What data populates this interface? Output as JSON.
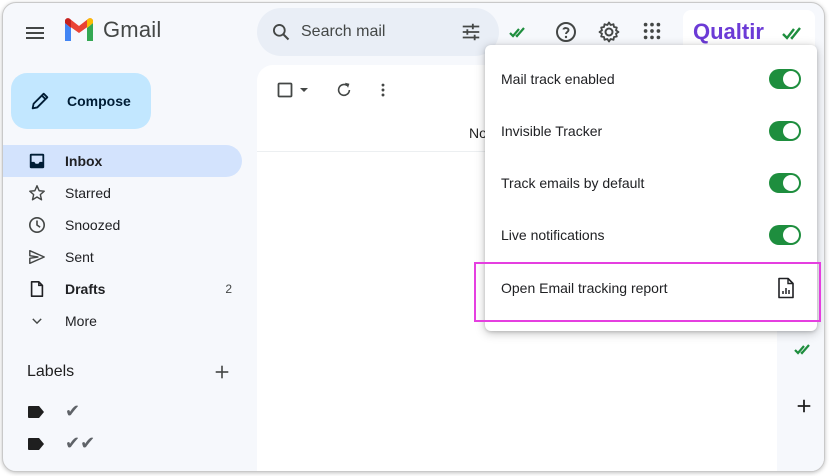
{
  "app": {
    "logo_text": "Gmail",
    "brand_text": "Qualtir"
  },
  "search": {
    "placeholder": "Search mail"
  },
  "compose": {
    "label": "Compose"
  },
  "nav": {
    "items": [
      {
        "label": "Inbox",
        "icon": "inbox-icon",
        "active": true,
        "bold": true,
        "count": ""
      },
      {
        "label": "Starred",
        "icon": "star-icon",
        "active": false,
        "bold": false,
        "count": ""
      },
      {
        "label": "Snoozed",
        "icon": "clock-icon",
        "active": false,
        "bold": false,
        "count": ""
      },
      {
        "label": "Sent",
        "icon": "send-icon",
        "active": false,
        "bold": false,
        "count": ""
      },
      {
        "label": "Drafts",
        "icon": "draft-icon",
        "active": false,
        "bold": true,
        "count": "2"
      },
      {
        "label": "More",
        "icon": "chevron-down-icon",
        "active": false,
        "bold": false,
        "count": ""
      }
    ]
  },
  "labels": {
    "heading": "Labels",
    "items": [
      {
        "text": "✔",
        "icon": "label-icon"
      },
      {
        "text": "✔✔",
        "icon": "label-icon"
      }
    ]
  },
  "main": {
    "partial_text": "No"
  },
  "popup": {
    "rows": [
      {
        "label": "Mail track enabled",
        "toggle_on": true
      },
      {
        "label": "Invisible Tracker",
        "toggle_on": true
      },
      {
        "label": "Track emails by default",
        "toggle_on": true
      },
      {
        "label": "Live notifications",
        "toggle_on": true
      }
    ],
    "report": {
      "label": "Open Email tracking report",
      "icon": "report-document-icon"
    }
  },
  "colors": {
    "accent_green": "#1e8e3e",
    "highlight": "#e53fe0",
    "compose_bg": "#c2e7ff",
    "active_nav": "#d3e3fd",
    "brand_purple": "#6c3bd6"
  }
}
